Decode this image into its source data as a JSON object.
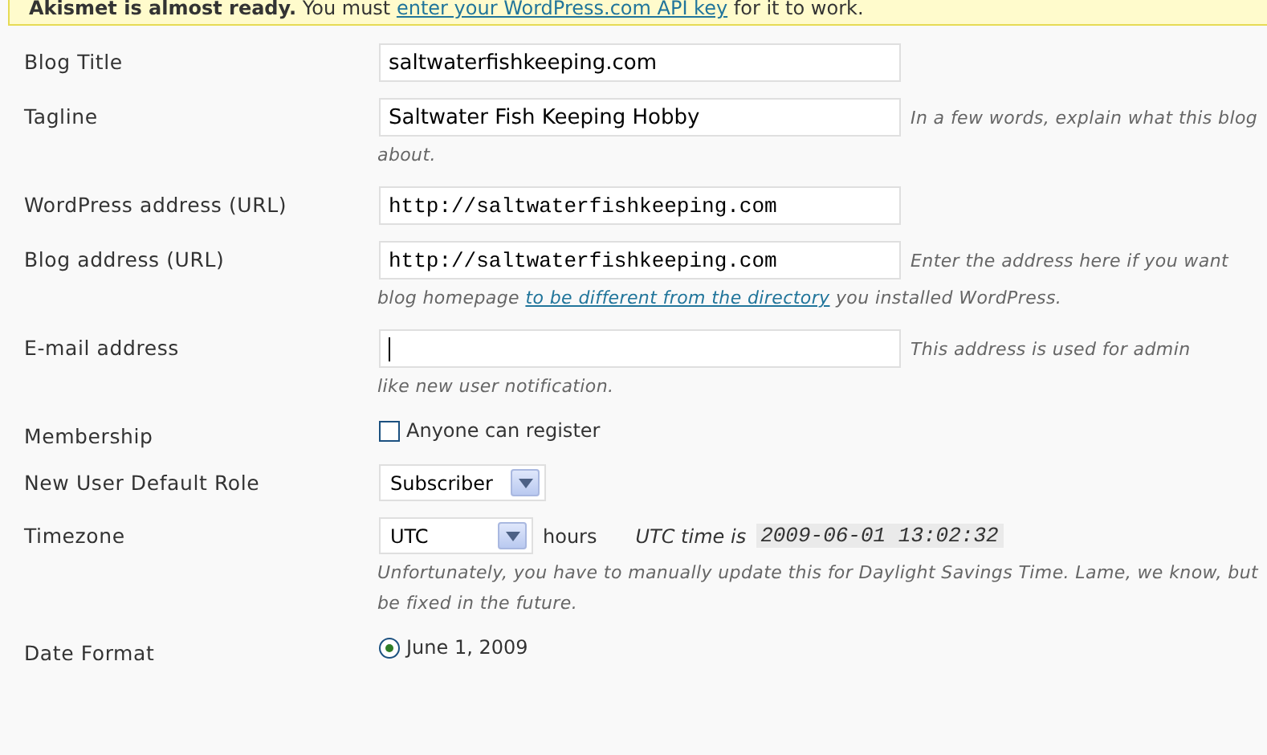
{
  "notice": {
    "lead": "**Akismet is almost ready.** You must ",
    "link": "enter your WordPress.com API key",
    "tail": " for it to work."
  },
  "settings": [
    {
      "label": "Blog Title",
      "kind": "text",
      "value": "saltwaterfishkeeping.com"
    },
    {
      "label": "Tagline",
      "kind": "text",
      "value": "Saltwater Fish Keeping Hobby",
      "description": [
        {
          "text": "In a few words, explain what this blog"
        },
        {
          "text": "about."
        }
      ]
    },
    {
      "label": "WordPress address (URL)",
      "kind": "url",
      "value": "http://saltwaterfishkeeping.com"
    },
    {
      "label": "Blog address (URL)",
      "kind": "url",
      "value": "http://saltwaterfishkeeping.com",
      "description": [
        {
          "text": "Enter the address here if you want"
        },
        {
          "text": "blog homepage ",
          "link": "to be different from the directory",
          "after": " you installed WordPress."
        }
      ]
    },
    {
      "label": "E-mail address",
      "kind": "text",
      "focused": true,
      "description": [
        {
          "text": "This address is used for admin"
        },
        {
          "text": "like new user notification."
        }
      ]
    },
    {
      "label": "Membership",
      "kind": "checkbox",
      "option": "Anyone can register",
      "checked": false
    },
    {
      "label": "New User Default Role",
      "kind": "select",
      "value": "Subscriber"
    },
    {
      "label": "Timezone",
      "kind": "timezone",
      "value": "UTC",
      "suffix": "hours",
      "utc_label": "UTC time is",
      "utc_time": "2009-06-01 13:02:32",
      "description": [
        {
          "text": "Unfortunately, you have to manually update this for Daylight Savings Time. Lame, we know, but"
        },
        {
          "text": "be fixed in the future."
        }
      ]
    },
    {
      "label": "Date Format",
      "kind": "radio",
      "option": "June 1, 2009",
      "selected": true
    }
  ]
}
